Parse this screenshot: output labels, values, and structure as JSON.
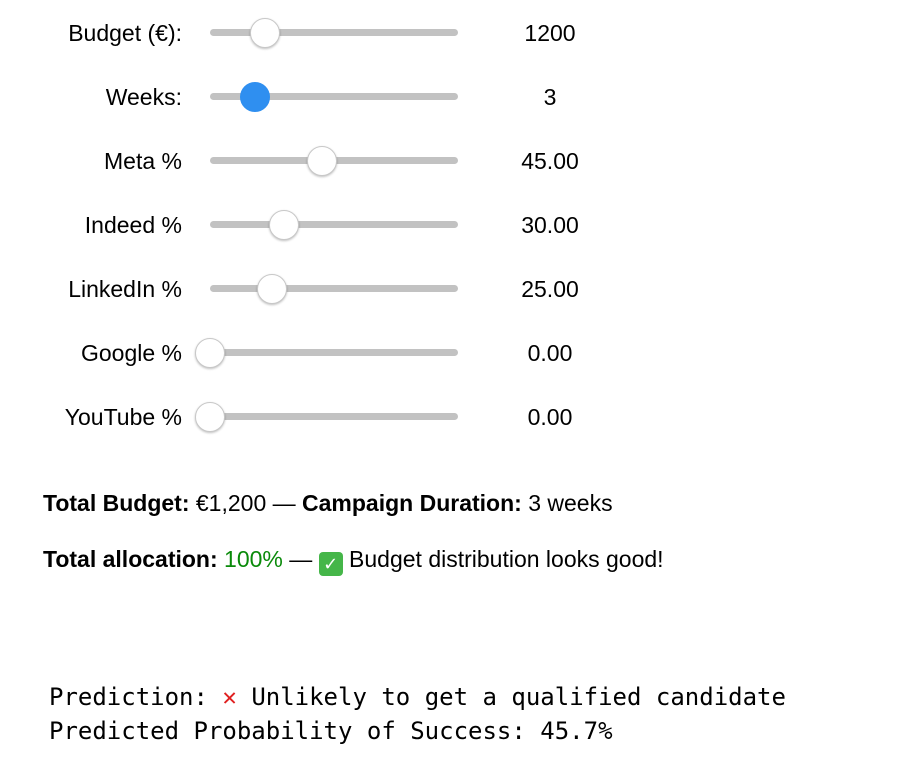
{
  "sliders": [
    {
      "label": "Budget (€):",
      "value": "1200",
      "fraction": 0.22,
      "active": false
    },
    {
      "label": "Weeks:",
      "value": "3",
      "fraction": 0.18,
      "active": true
    },
    {
      "label": "Meta %",
      "value": "45.00",
      "fraction": 0.45,
      "active": false
    },
    {
      "label": "Indeed %",
      "value": "30.00",
      "fraction": 0.3,
      "active": false
    },
    {
      "label": "LinkedIn %",
      "value": "25.00",
      "fraction": 0.25,
      "active": false
    },
    {
      "label": "Google %",
      "value": "0.00",
      "fraction": 0.0,
      "active": false
    },
    {
      "label": "YouTube %",
      "value": "0.00",
      "fraction": 0.0,
      "active": false
    }
  ],
  "summary": {
    "total_budget_label": "Total Budget:",
    "total_budget_value": "€1,200",
    "separator": "—",
    "duration_label": "Campaign Duration:",
    "duration_value": "3 weeks",
    "allocation_label": "Total allocation:",
    "allocation_value": "100%",
    "allocation_message": "Budget distribution looks good!"
  },
  "prediction": {
    "label": "Prediction:",
    "result": "Unlikely to get a qualified candidate",
    "probability_label": "Predicted Probability of Success:",
    "probability_value": "45.7%"
  },
  "colors": {
    "active_thumb": "#2f8ff0",
    "success_green": "#0a8a0a",
    "cross_red": "#e02020",
    "track": "#c2c2c2"
  },
  "icons": {
    "status_ok": "check-mark-icon",
    "status_fail": "cross-mark-icon"
  }
}
